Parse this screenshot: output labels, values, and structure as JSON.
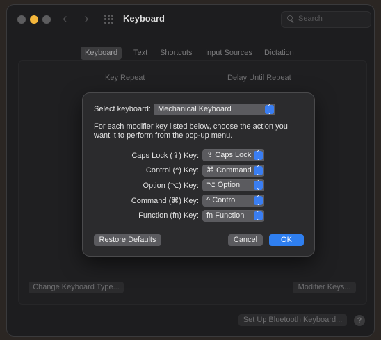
{
  "window": {
    "title": "Keyboard"
  },
  "search": {
    "placeholder": "Search"
  },
  "tabs": [
    {
      "label": "Keyboard",
      "active": true
    },
    {
      "label": "Text",
      "active": false
    },
    {
      "label": "Shortcuts",
      "active": false
    },
    {
      "label": "Input Sources",
      "active": false
    },
    {
      "label": "Dictation",
      "active": false
    }
  ],
  "background": {
    "key_repeat_label": "Key Repeat",
    "delay_label": "Delay Until Repeat",
    "change_type_button": "Change Keyboard Type...",
    "modifier_keys_button": "Modifier Keys...",
    "bluetooth_button": "Set Up Bluetooth Keyboard...",
    "help_label": "?"
  },
  "dialog": {
    "select_label": "Select keyboard:",
    "selected_keyboard": "Mechanical Keyboard",
    "description": "For each modifier key listed below, choose the action you want it to perform from the pop-up menu.",
    "rows": [
      {
        "label": "Caps Lock (⇪) Key:",
        "value": "⇪ Caps Lock"
      },
      {
        "label": "Control (^) Key:",
        "value": "⌘ Command"
      },
      {
        "label": "Option (⌥) Key:",
        "value": "⌥ Option"
      },
      {
        "label": "Command (⌘) Key:",
        "value": "^ Control"
      },
      {
        "label": "Function (fn) Key:",
        "value": "fn Function"
      }
    ],
    "restore_button": "Restore Defaults",
    "cancel_button": "Cancel",
    "ok_button": "OK"
  },
  "colors": {
    "accent": "#2f7ff0",
    "window_bg": "#1d1d1f",
    "dialog_bg": "#2b2b2d"
  }
}
